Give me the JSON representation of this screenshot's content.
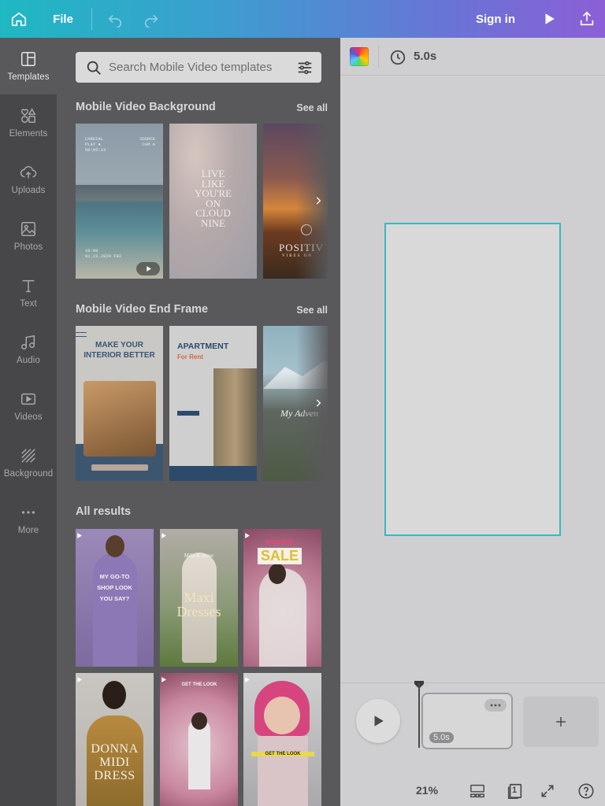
{
  "topbar": {
    "file_label": "File",
    "signin_label": "Sign in",
    "icons": [
      "home-icon",
      "undo-icon",
      "redo-icon",
      "play-icon",
      "share-icon"
    ]
  },
  "rail": {
    "items": [
      {
        "label": "Templates",
        "icon": "templates-icon",
        "active": true
      },
      {
        "label": "Elements",
        "icon": "elements-icon"
      },
      {
        "label": "Uploads",
        "icon": "upload-cloud-icon"
      },
      {
        "label": "Photos",
        "icon": "photo-icon"
      },
      {
        "label": "Text",
        "icon": "text-icon"
      },
      {
        "label": "Audio",
        "icon": "music-note-icon"
      },
      {
        "label": "Videos",
        "icon": "video-icon"
      },
      {
        "label": "Background",
        "icon": "background-pattern-icon"
      },
      {
        "label": "More",
        "icon": "more-dots-icon"
      }
    ]
  },
  "search": {
    "placeholder": "Search Mobile Video templates"
  },
  "sections": {
    "background": {
      "title": "Mobile Video Background",
      "see_all": "See all",
      "thumbs": [
        {
          "text_top_left": "CARDIAL\nPLAY ●\n00:05:23",
          "text_top_right": "SOURCE\nCAM A",
          "text_bottom": "10:00\n01.22.2024 FRI"
        },
        {
          "text": "LIVE\nLIKE\nYOU'RE\nON\nCLOUD\nNINE"
        },
        {
          "text": "POSITIV",
          "subtext": "VIBES ON"
        }
      ]
    },
    "endframe": {
      "title": "Mobile Video End Frame",
      "see_all": "See all",
      "thumbs": [
        {
          "title": "MAKE YOUR\nINTERIOR BETTER"
        },
        {
          "title": "APARTMENT",
          "subtitle": "For Rent"
        },
        {
          "title": "My Adven"
        }
      ]
    },
    "results": {
      "title": "All results",
      "thumbs": [
        {
          "text": "MY GO-TO\nSHOP LOOK\nYOU SAY?"
        },
        {
          "text": "Maxi\nDresses",
          "small": "Mila & Stone"
        },
        {
          "text": "SALE",
          "small": "WEEKEND"
        },
        {
          "text": "DONNA\nMIDI\nDRESS"
        },
        {
          "text": "GET THE LOOK"
        },
        {
          "text": "GET THE LOOK"
        }
      ]
    }
  },
  "canvas": {
    "duration": "5.0s",
    "accent": "#3bb8c0"
  },
  "timeline": {
    "clip_duration": "5.0s",
    "zoom": "21%",
    "page_count": "1"
  }
}
